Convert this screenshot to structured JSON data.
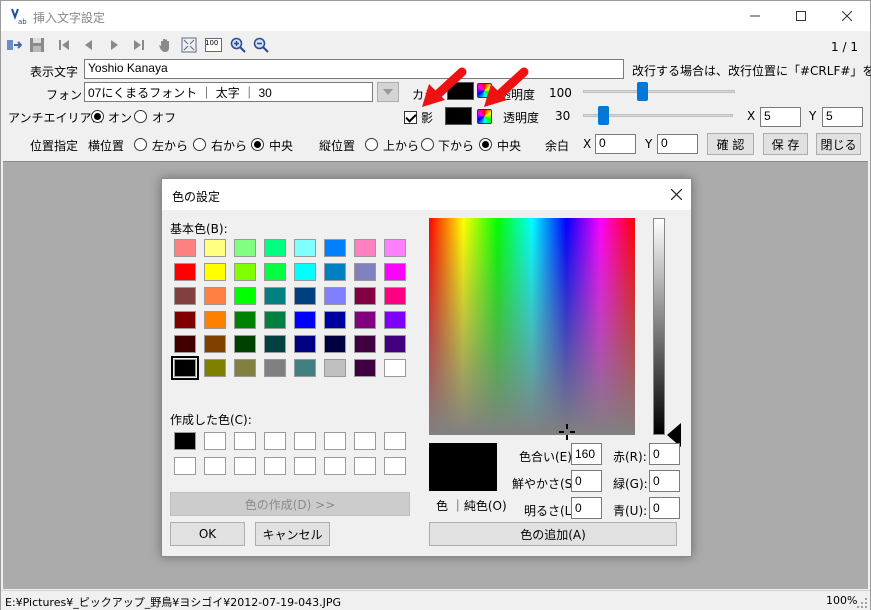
{
  "window": {
    "title": "挿入文字設定",
    "page_count": "1 / 1"
  },
  "toolbar": {
    "icons": [
      "import-icon",
      "save-icon",
      "first-page-icon",
      "prev-page-icon",
      "next-page-icon",
      "last-page-icon",
      "hand-icon",
      "fit-icon",
      "actual-size-icon",
      "zoom-in-icon",
      "zoom-out-icon"
    ],
    "actual_size_label": "100"
  },
  "form": {
    "display_text_label": "表示文字",
    "display_text_value": "Yoshio Kanaya",
    "newline_note": "改行する場合は、改行位置に「#CRLF#」を入力",
    "font_label": "フォント",
    "font_value": "07にくまるフォント ｜ 太字 ｜ 30",
    "color_label": "カラ",
    "opacity_label": "透明度",
    "opacity_value": "100",
    "antialias_label": "アンチエイリアス",
    "antialias_on": "オン",
    "antialias_off": "オフ",
    "shadow_label": "影",
    "shadow_opacity_label": "透明度",
    "shadow_opacity_value": "30",
    "shadow_x_label": "X",
    "shadow_x_value": "5",
    "shadow_y_label": "Y",
    "shadow_y_value": "5",
    "position_label": "位置指定",
    "horizontal_label": "横位置",
    "h_left": "左から",
    "h_right": "右から",
    "h_center": "中央",
    "vertical_label": "縦位置",
    "v_top": "上から",
    "v_bottom": "下から",
    "v_center": "中央",
    "margin_label": "余白",
    "margin_x_label": "X",
    "margin_x_value": "0",
    "margin_y_label": "Y",
    "margin_y_value": "0",
    "confirm_button": "確 認",
    "save_button": "保 存",
    "close_button": "閉じる"
  },
  "status": {
    "path": "E:¥Pictures¥_ピックアップ_野鳥¥ヨシゴイ¥2012-07-19-043.JPG",
    "zoom": "100%"
  },
  "dialog": {
    "title": "色の設定",
    "basic_colors_label": "基本色(B):",
    "basic_colors": [
      [
        "#ff8080",
        "#ffff80",
        "#80ff80",
        "#00ff80",
        "#80ffff",
        "#0080ff",
        "#ff80c0",
        "#ff80ff"
      ],
      [
        "#ff0000",
        "#ffff00",
        "#80ff00",
        "#00ff40",
        "#00ffff",
        "#0080c0",
        "#8080c0",
        "#ff00ff"
      ],
      [
        "#804040",
        "#ff8040",
        "#00ff00",
        "#008080",
        "#004080",
        "#8080ff",
        "#800040",
        "#ff0080"
      ],
      [
        "#800000",
        "#ff8000",
        "#008000",
        "#008040",
        "#0000ff",
        "#0000a0",
        "#800080",
        "#8000ff"
      ],
      [
        "#400000",
        "#804000",
        "#004000",
        "#004040",
        "#000080",
        "#000040",
        "#400040",
        "#400080"
      ],
      [
        "#000000",
        "#808000",
        "#808040",
        "#808080",
        "#408080",
        "#c0c0c0",
        "#400040",
        "#ffffff"
      ]
    ],
    "custom_colors_label": "作成した色(C):",
    "define_custom_button": "色の作成(D) >>",
    "ok_button": "OK",
    "cancel_button": "キャンセル",
    "color_solid_label": "色 ｜純色(O)",
    "hue_label": "色合い(E):",
    "hue_value": "160",
    "sat_label": "鮮やかさ(S):",
    "sat_value": "0",
    "lum_label": "明るさ(L):",
    "lum_value": "0",
    "red_label": "赤(R):",
    "red_value": "0",
    "green_label": "緑(G):",
    "green_value": "0",
    "blue_label": "青(U):",
    "blue_value": "0",
    "add_custom_button": "色の追加(A)"
  }
}
